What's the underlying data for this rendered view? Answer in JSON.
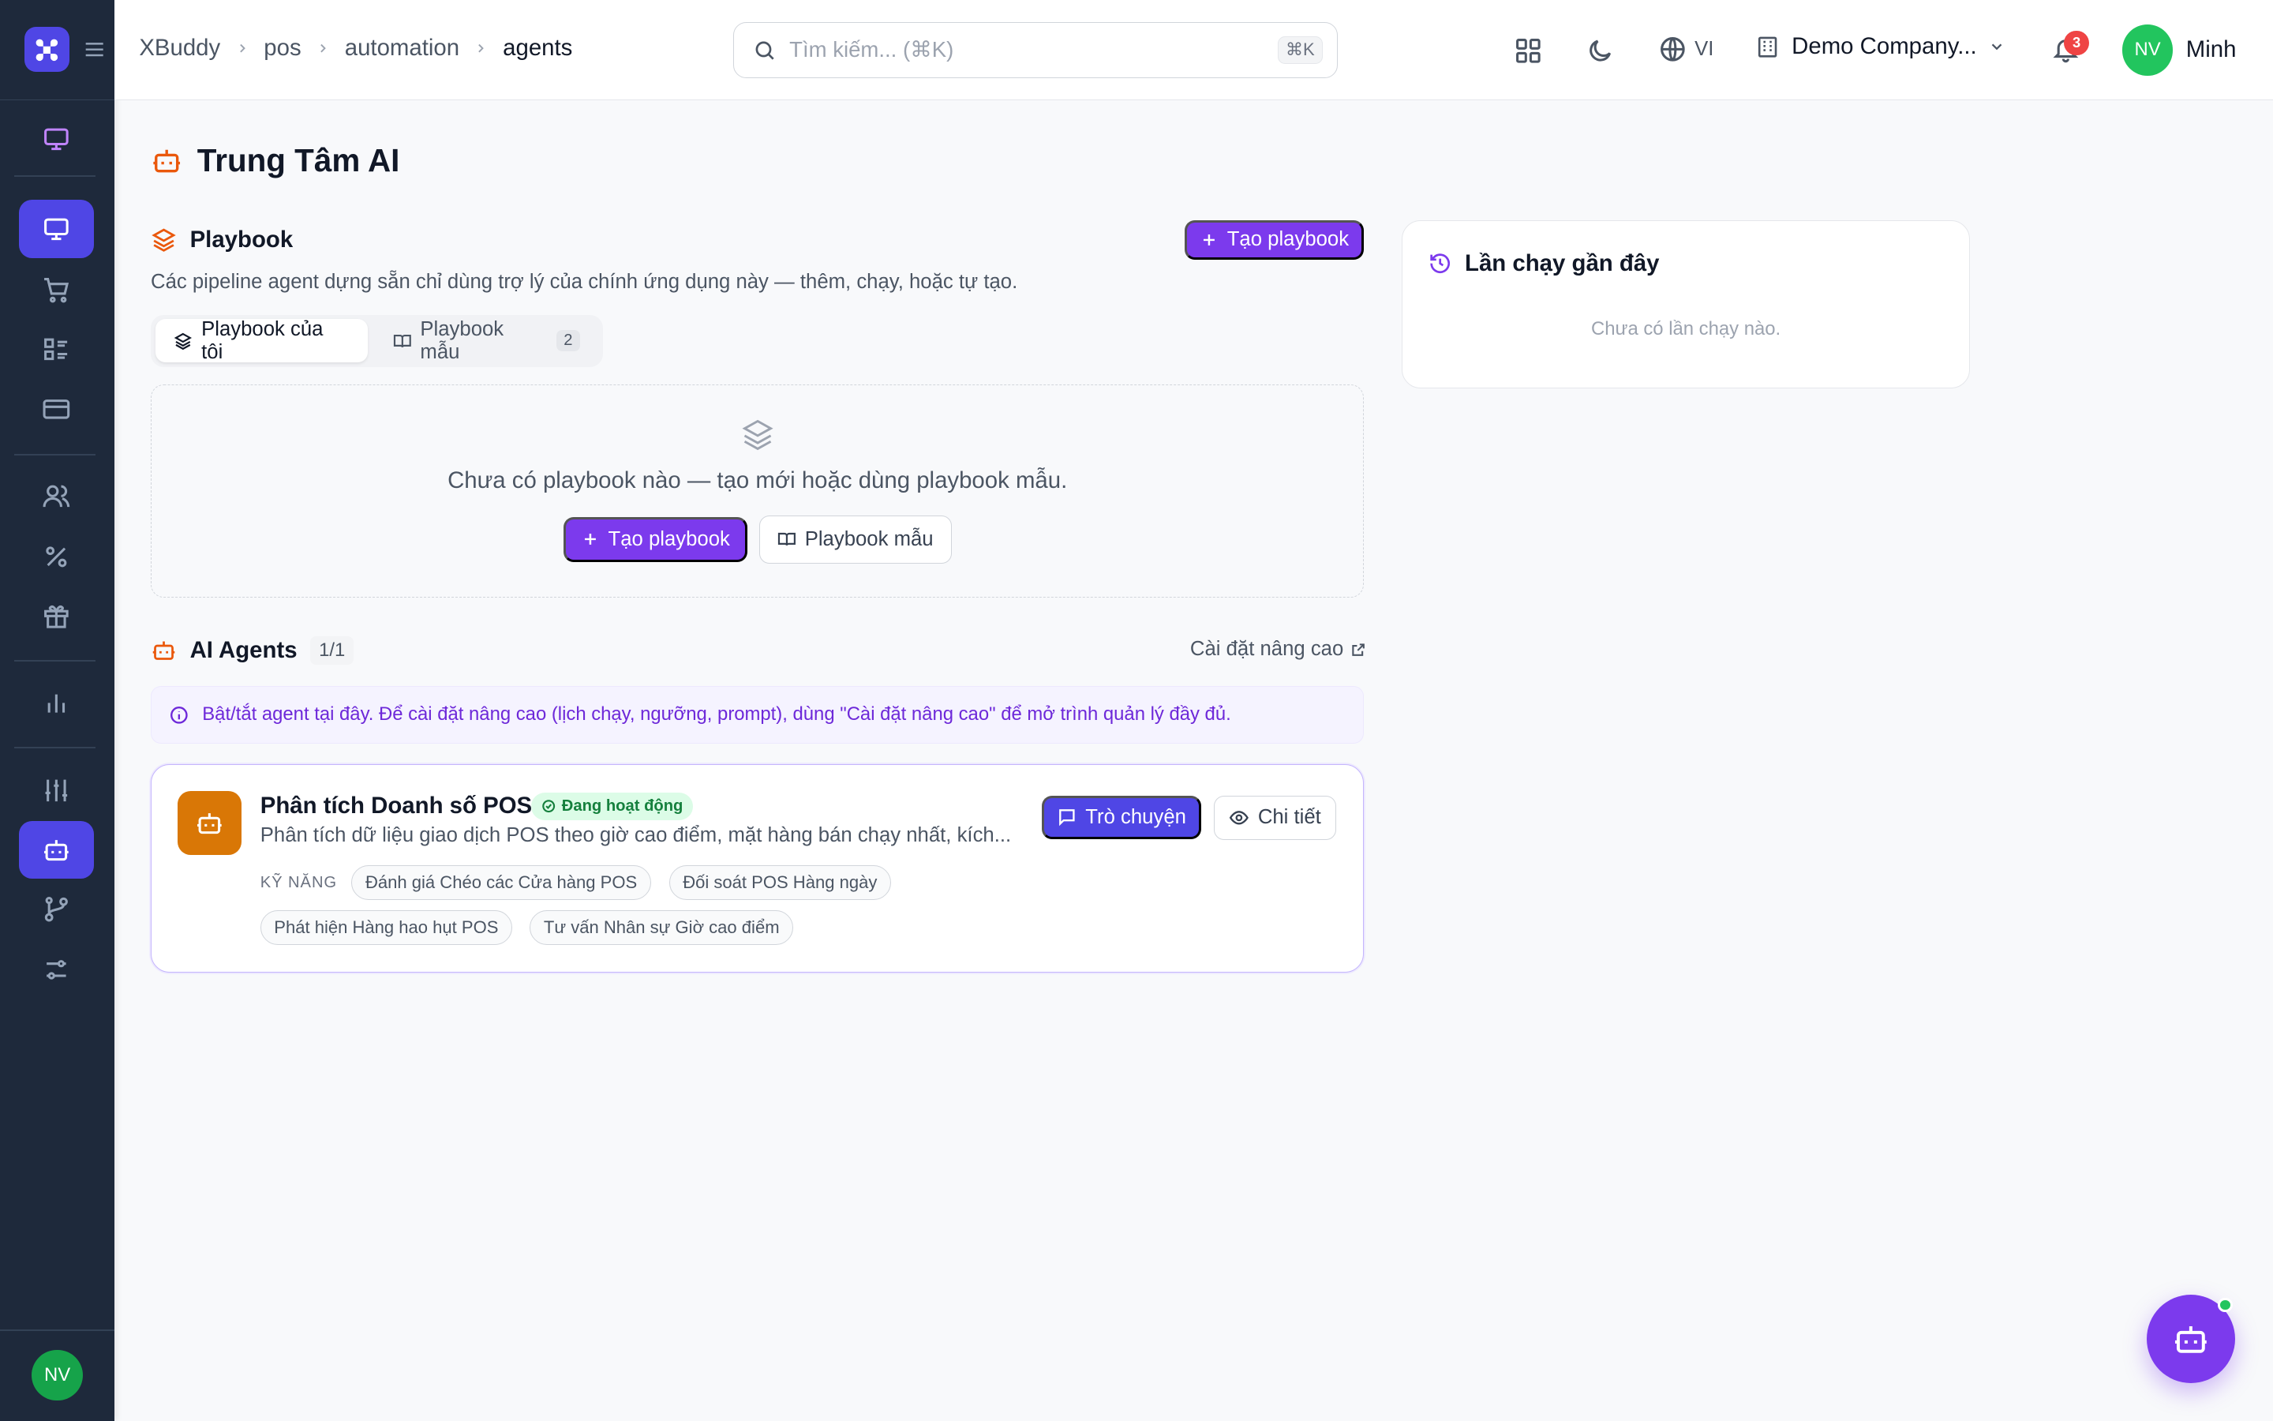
{
  "colors": {
    "sidebar_bg": "#1e293b",
    "accent": "#7c3aed",
    "active_nav": "#4f46e5",
    "orange": "#d97706",
    "success": "#15803d",
    "danger": "#ef4444"
  },
  "sidebar": {
    "avatar_initials": "NV",
    "items": [
      {
        "icon": "monitor-icon"
      },
      {
        "icon": "monitor-icon",
        "active": true
      },
      {
        "icon": "cart-icon"
      },
      {
        "icon": "list-icon"
      },
      {
        "icon": "credit-card-icon"
      },
      {
        "icon": "users-icon"
      },
      {
        "icon": "percent-icon"
      },
      {
        "icon": "gift-icon"
      },
      {
        "icon": "bar-chart-icon"
      },
      {
        "icon": "sliders-icon"
      },
      {
        "icon": "bot-icon",
        "active": true
      },
      {
        "icon": "git-branch-icon"
      },
      {
        "icon": "settings-sliders-icon"
      }
    ]
  },
  "header": {
    "breadcrumb": [
      "XBuddy",
      "pos",
      "automation",
      "agents"
    ],
    "search_placeholder": "Tìm kiếm... (⌘K)",
    "search_shortcut": "⌘K",
    "language": "VI",
    "company": "Demo Company...",
    "notification_count": "3",
    "user_initials": "NV",
    "user_name": "Minh"
  },
  "page": {
    "title": "Trung Tâm AI"
  },
  "playbook": {
    "heading": "Playbook",
    "create_button": "Tạo playbook",
    "description": "Các pipeline agent dựng sẵn chỉ dùng trợ lý của chính ứng dụng này — thêm, chạy, hoặc tự tạo.",
    "tabs": [
      {
        "label": "Playbook của tôi"
      },
      {
        "label": "Playbook mẫu",
        "count": "2"
      }
    ],
    "empty_text": "Chưa có playbook nào — tạo mới hoặc dùng playbook mẫu.",
    "empty_create_button": "Tạo playbook",
    "empty_template_button": "Playbook mẫu"
  },
  "agents": {
    "heading": "AI Agents",
    "count": "1/1",
    "advanced_link": "Cài đặt nâng cao",
    "info": "Bật/tắt agent tại đây. Để cài đặt nâng cao (lịch chạy, ngưỡng, prompt), dùng \"Cài đặt nâng cao\" để mở trình quản lý đầy đủ.",
    "list": [
      {
        "name": "Phân tích Doanh số POS",
        "status": "Đang hoạt động",
        "description": "Phân tích dữ liệu giao dịch POS theo giờ cao điểm, mặt hàng bán chạy nhất, kích...",
        "chat_button": "Trò chuyện",
        "detail_button": "Chi tiết",
        "skills_label": "KỸ NĂNG",
        "skills": [
          "Đánh giá Chéo các Cửa hàng POS",
          "Đối soát POS Hàng ngày",
          "Phát hiện Hàng hao hụt POS",
          "Tư vấn Nhân sự Giờ cao điểm"
        ]
      }
    ]
  },
  "recent_runs": {
    "title": "Lần chạy gần đây",
    "empty": "Chưa có lần chạy nào."
  }
}
